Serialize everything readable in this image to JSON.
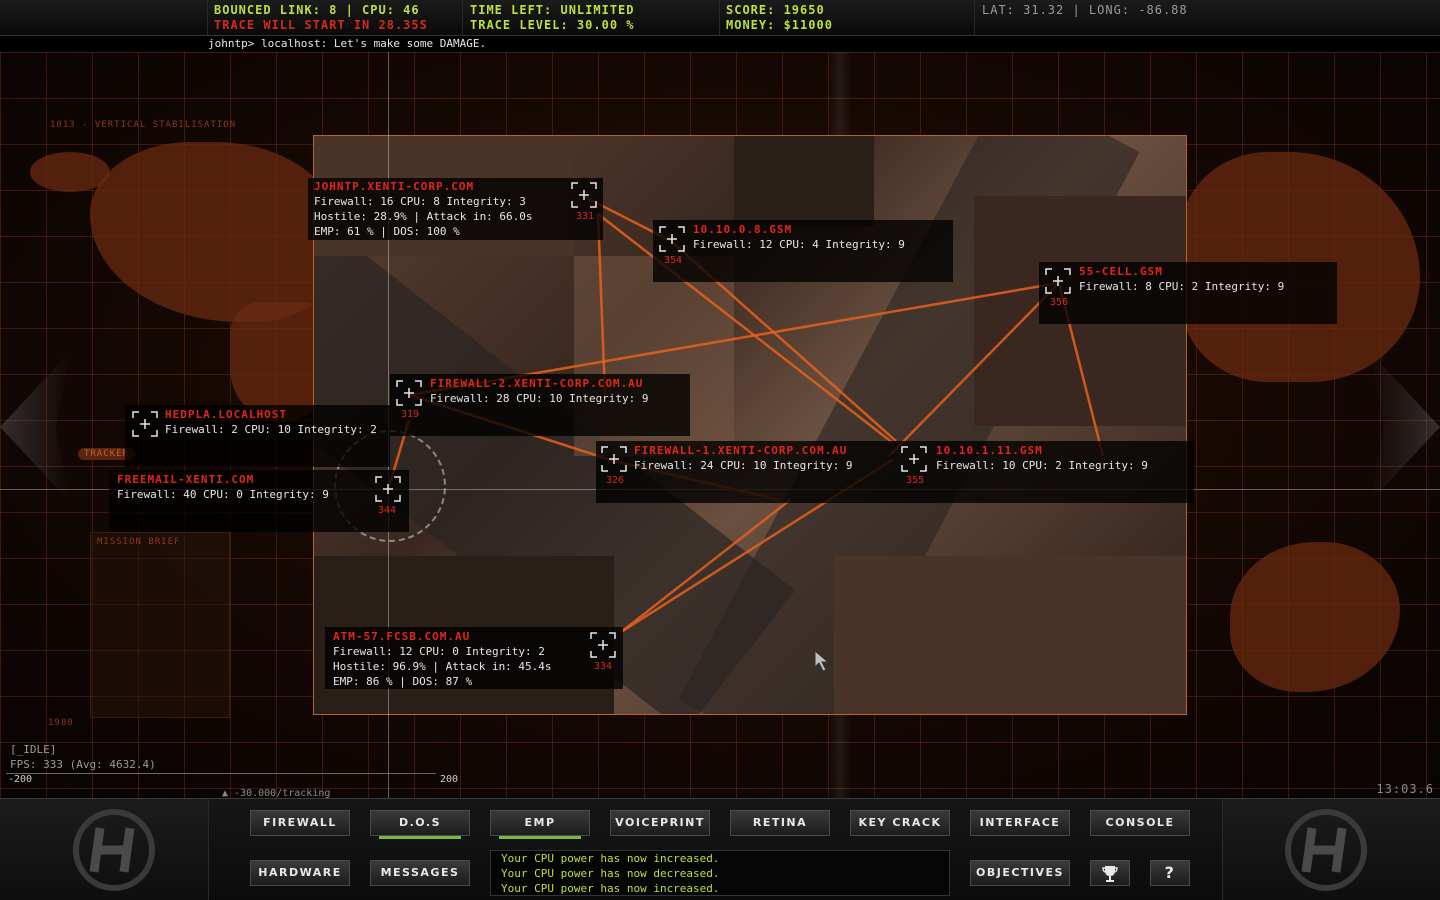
{
  "hud": {
    "bounced_link": "BOUNCED LINK: 8 | CPU: 46",
    "trace_start": "TRACE WILL START IN 28.35s",
    "time_left": "TIME LEFT: UNLIMITED",
    "trace_level": "TRACE LEVEL: 30.00 %",
    "score": "SCORE: 19650",
    "money": "MONEY: $11000",
    "latlong": "LAT: 31.32 | LONG: -86.88"
  },
  "console_line": "johntp> localhost: Let's make some DAMAGE.",
  "map_faint": {
    "stabilisation": "1013 - VERTICAL STABILISATION",
    "tracker": "TRACKER",
    "year": "1980",
    "mission": "MISSION BRIEF"
  },
  "nodes": [
    {
      "id": "johntp",
      "title": "JOHNTP.XENTI-CORP.COM",
      "lines": [
        "Firewall: 16 CPU: 8 Integrity: 3",
        "Hostile: 28.9% | Attack in: 66.0s",
        "EMP:  61 % | DOS: 100 %"
      ],
      "num": "331"
    },
    {
      "id": "gsm8",
      "title": "10.10.0.8.GSM",
      "lines": [
        "Firewall: 12 CPU: 4 Integrity: 9"
      ],
      "num": "354"
    },
    {
      "id": "cell55",
      "title": "55-CELL.GSM",
      "lines": [
        "Firewall: 8 CPU: 2 Integrity: 9"
      ],
      "num": "356"
    },
    {
      "id": "fw2",
      "title": "FIREWALL-2.XENTI-CORP.COM.AU",
      "lines": [
        "Firewall: 28 CPU: 10 Integrity: 9"
      ],
      "num": "319"
    },
    {
      "id": "hedpla",
      "title": "HEDPLA.LOCALHOST",
      "lines": [
        "Firewall: 2 CPU: 10 Integrity: 2"
      ],
      "num": ""
    },
    {
      "id": "fw1",
      "title": "FIREWALL-1.XENTI-CORP.COM.AU",
      "lines": [
        "Firewall: 24 CPU: 10 Integrity: 9"
      ],
      "num": "326"
    },
    {
      "id": "gsm111",
      "title": "10.10.1.11.GSM",
      "lines": [
        "Firewall: 10 CPU: 2 Integrity: 9"
      ],
      "num": "355"
    },
    {
      "id": "freemail",
      "title": "FREEMAIL-XENTI.COM",
      "lines": [
        "Firewall: 40 CPU: 0 Integrity: 9"
      ],
      "num": "344"
    },
    {
      "id": "atm",
      "title": "ATM-57.FCSB.COM.AU",
      "lines": [
        "Firewall: 12 CPU: 0 Integrity: 2",
        "Hostile: 96.9% | Attack in: 45.4s",
        "EMP:  86 % | DOS:  87 %"
      ],
      "num": "334"
    }
  ],
  "status": {
    "idle": "[_IDLE]",
    "fps": "FPS: 333 (Avg: 4632.4)",
    "scale_left": "-200",
    "scale_right": "200",
    "tracking": "-30.000/tracking",
    "clock": "13:03.6"
  },
  "toolbar": {
    "firewall": "FIREWALL",
    "dos": "D.O.S",
    "emp": "EMP",
    "voiceprint": "VOICEPRINT",
    "retina": "RETINA",
    "keycrack": "KEY CRACK",
    "interface": "INTERFACE",
    "console": "CONSOLE",
    "hardware": "HARDWARE",
    "messages": "MESSAGES",
    "objectives": "OBJECTIVES",
    "help": "?"
  },
  "messages": [
    "Your CPU power has now increased.",
    "Your CPU power has now decreased.",
    "Your CPU power has now increased."
  ],
  "colors": {
    "accent_green": "#b9e23c",
    "alert_red": "#d42a1e",
    "link_orange": "#e8601c"
  }
}
